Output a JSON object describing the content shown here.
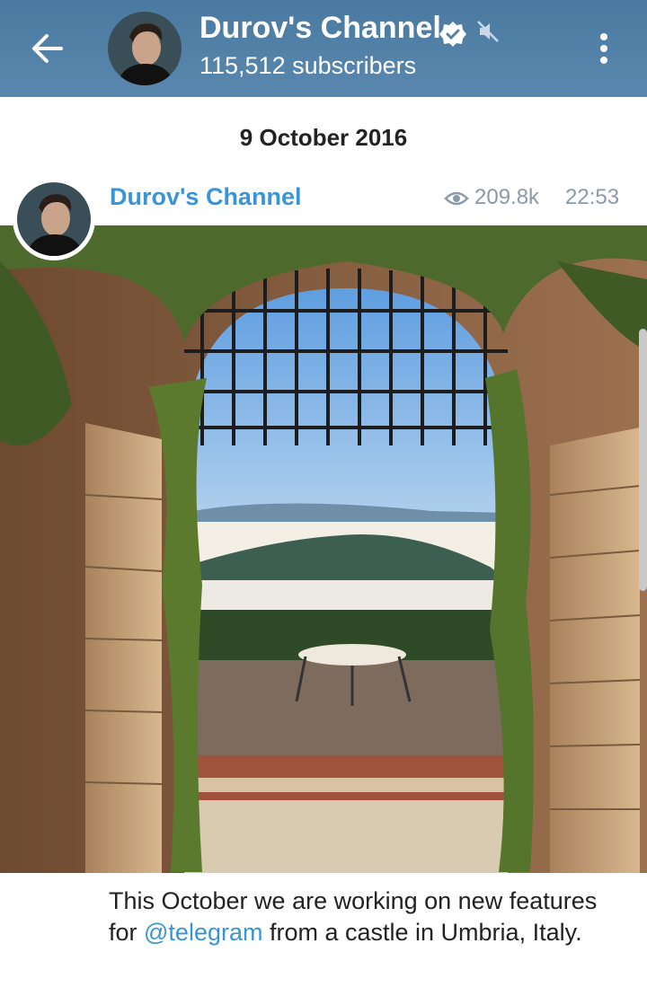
{
  "header": {
    "title": "Durov's Channel",
    "subtitle": "115,512 subscribers",
    "back_icon": "arrow-left-icon",
    "verified_icon": "verified-badge-icon",
    "muted_icon": "muted-speaker-icon",
    "menu_icon": "more-vertical-icon",
    "bg_color": "#5682a3"
  },
  "chat": {
    "date_separator": "9 October 2016",
    "post": {
      "author": "Durov's Channel",
      "views": "209.8k",
      "time": "22:53",
      "photo_icon": "castle-archway-photo",
      "caption_before": "This October we are working on new features for ",
      "caption_mention": "@telegram",
      "caption_after": " from a castle in Umbria, Italy.",
      "accent_color": "#3a95d4"
    }
  }
}
